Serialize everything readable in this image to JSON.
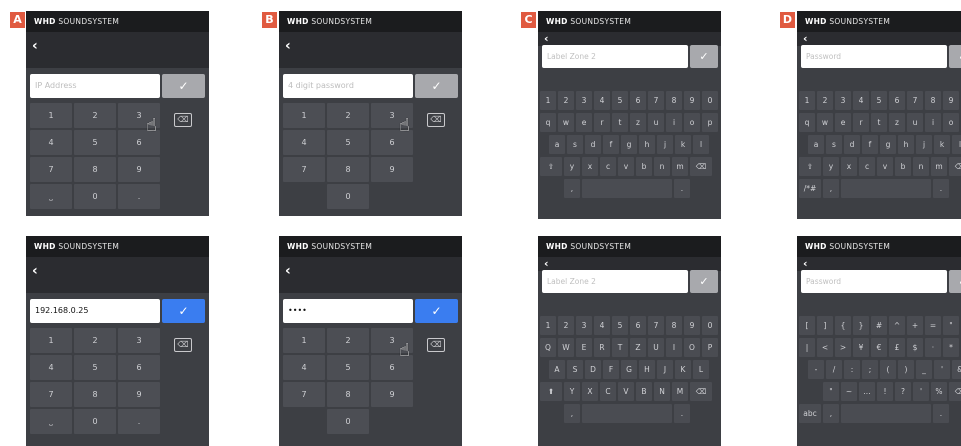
{
  "labels": {
    "a": "A",
    "b": "B",
    "c": "C",
    "d": "D"
  },
  "brand": {
    "bold": "WHD",
    "rest": " SOUNDSYSTEM"
  },
  "back_glyph": "‹",
  "check_glyph": "✓",
  "delete_glyph": "⌫",
  "hand_glyph": "☝",
  "numeric_keys": [
    "1",
    "2",
    "3",
    "4",
    "5",
    "6",
    "7",
    "8",
    "9"
  ],
  "space_glyph": "⎵",
  "zero": "0",
  "dot": ".",
  "screens": {
    "a1": {
      "placeholder": "IP Address"
    },
    "b1": {
      "placeholder": "4 digit password"
    },
    "a2": {
      "value": "192.168.0.25"
    },
    "b2": {
      "value": "••••"
    },
    "c1": {
      "placeholder": "Label Zone 2"
    },
    "d1": {
      "placeholder": "Password"
    },
    "c2": {
      "placeholder": "Label Zone 2"
    },
    "d2": {
      "placeholder": "Password"
    }
  },
  "keyboard": {
    "digits": [
      "1",
      "2",
      "3",
      "4",
      "5",
      "6",
      "7",
      "8",
      "9",
      "0"
    ],
    "lower_row1": [
      "q",
      "w",
      "e",
      "r",
      "t",
      "z",
      "u",
      "i",
      "o",
      "p"
    ],
    "lower_row2": [
      "a",
      "s",
      "d",
      "f",
      "g",
      "h",
      "j",
      "k",
      "l"
    ],
    "lower_row3": [
      "y",
      "x",
      "c",
      "v",
      "b",
      "n",
      "m"
    ],
    "upper_row1": [
      "Q",
      "W",
      "E",
      "R",
      "T",
      "Z",
      "U",
      "I",
      "O",
      "P"
    ],
    "upper_row2": [
      "A",
      "S",
      "D",
      "F",
      "G",
      "H",
      "J",
      "K",
      "L"
    ],
    "upper_row3": [
      "Y",
      "X",
      "C",
      "V",
      "B",
      "N",
      "M"
    ],
    "sym_row1": [
      "[",
      "]",
      "{",
      "}",
      "#",
      "^",
      "+",
      "=",
      "\""
    ],
    "sym_row2": [
      "|",
      "<",
      ">",
      "¥",
      "€",
      "£",
      "$",
      "·",
      "*"
    ],
    "sym_row3": [
      "-",
      "/",
      ":",
      ";",
      "(",
      ")",
      "_",
      "'",
      "&"
    ],
    "sym_row4": [
      "\"",
      "~",
      "...",
      "!",
      "?",
      "'",
      "%"
    ],
    "shift_lower": "⇧",
    "shift_upper": "⬆",
    "sym_toggle": "/*#",
    "abc_toggle": "abc",
    "comma": ",",
    "period": "."
  }
}
